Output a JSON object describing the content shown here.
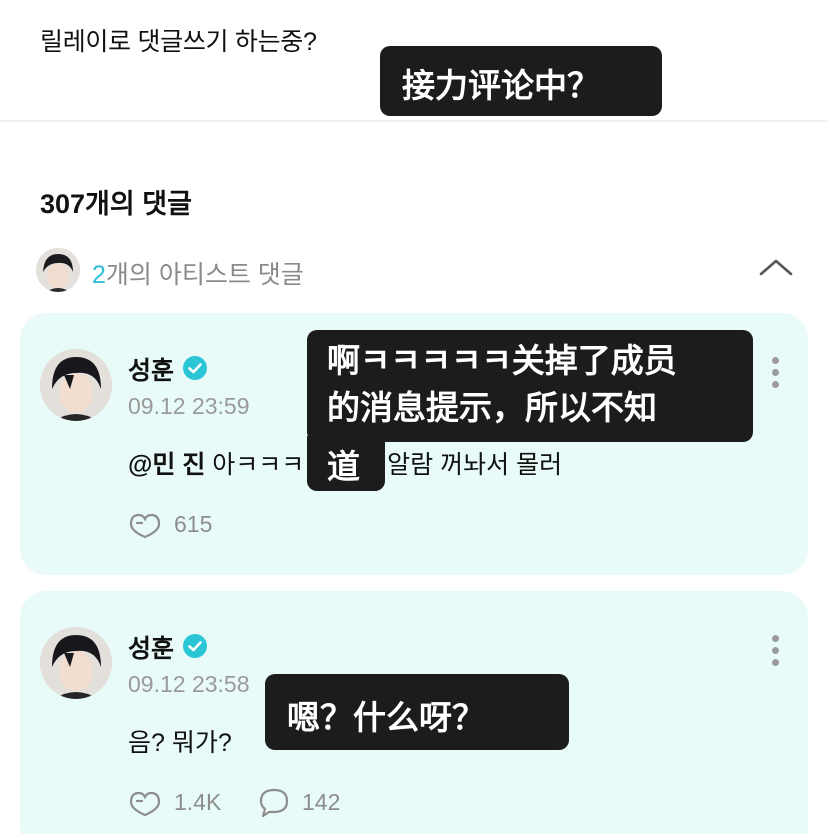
{
  "post": {
    "text": "릴레이로 댓글쓰기 하는중?"
  },
  "comments_header": {
    "count_label": "307개의 댓글"
  },
  "artist_row": {
    "count": "2",
    "label": "개의 아티스트 댓글"
  },
  "comments": [
    {
      "author": "성훈",
      "time": "09.12 23:59",
      "mention": "@민 진",
      "text": "아ㅋㅋㅋ 멤버들 알람 꺼놔서 몰러",
      "likes": "615"
    },
    {
      "author": "성훈",
      "time": "09.12 23:58",
      "text": "음? 뭐가?",
      "likes": "1.4K",
      "replies": "142"
    }
  ],
  "overlays": {
    "title": "接力评论中？",
    "translation_1_line1": "啊ㅋㅋㅋㅋㅋ关掉了成员",
    "translation_1_line2": "的消息提示，所以不知",
    "translation_1_line3": "道",
    "translation_2": "嗯？什么呀？"
  },
  "colors": {
    "card_bg": "#e8fbf8",
    "accent": "#2bbfd2",
    "overlay_bg": "#1c1c1c"
  },
  "icons": [
    "verified-badge-icon",
    "chevron-up-icon",
    "more-vertical-icon",
    "like-icon",
    "reply-icon"
  ]
}
